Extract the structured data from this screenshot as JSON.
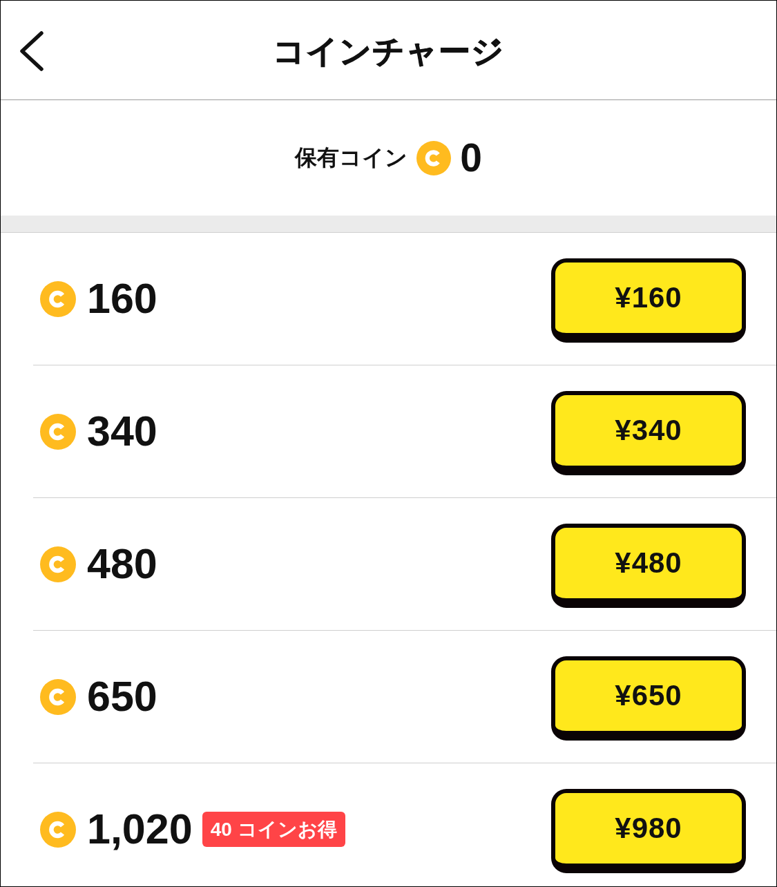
{
  "header": {
    "title": "コインチャージ"
  },
  "balance": {
    "label": "保有コイン",
    "amount": "0"
  },
  "packages": [
    {
      "coins": "160",
      "price": "¥160"
    },
    {
      "coins": "340",
      "price": "¥340"
    },
    {
      "coins": "480",
      "price": "¥480"
    },
    {
      "coins": "650",
      "price": "¥650"
    },
    {
      "coins": "1,020",
      "badge": "40 コインお得",
      "price": "¥980"
    }
  ]
}
